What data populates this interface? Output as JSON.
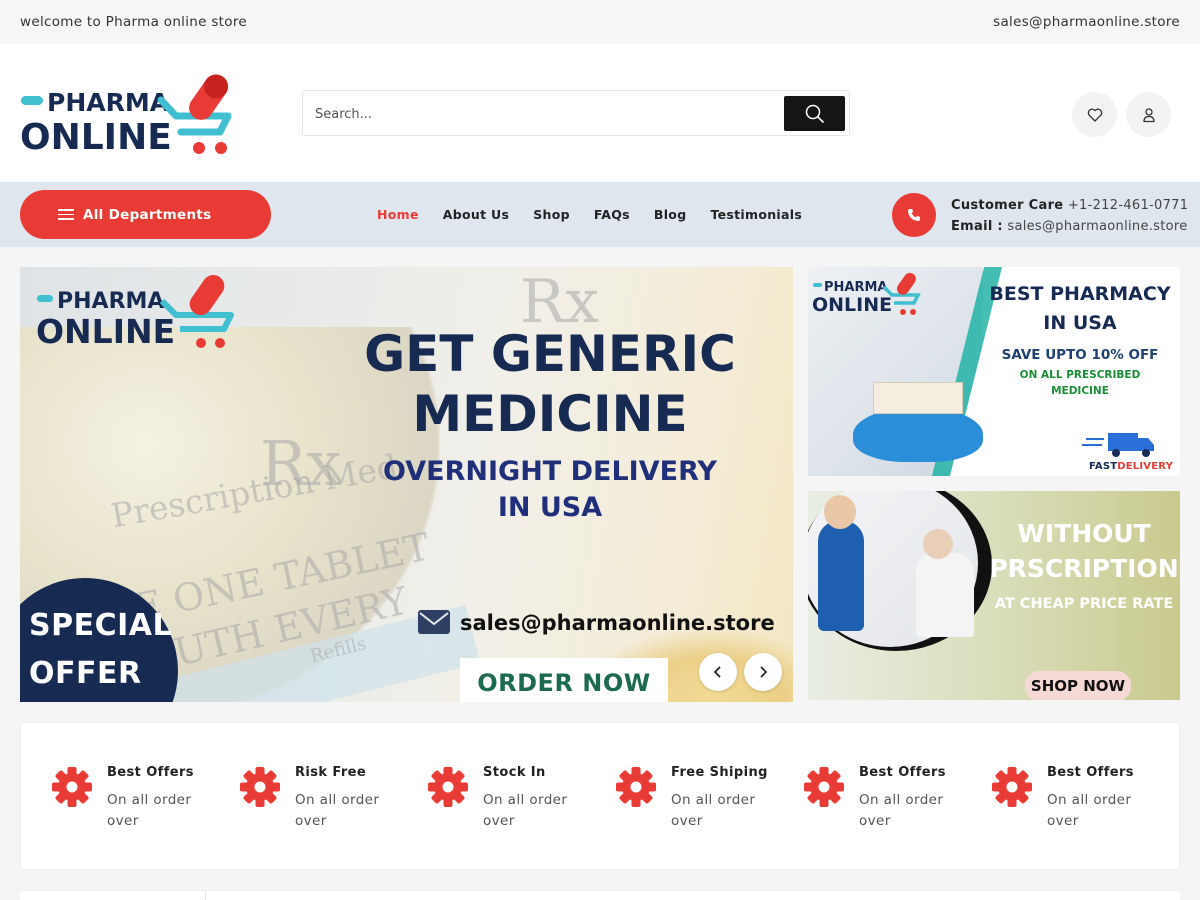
{
  "topbar": {
    "welcome": "welcome to Pharma online store",
    "email": "sales@pharmaonline.store"
  },
  "header": {
    "logo_line1": "PHARMA",
    "logo_line2": "ONLINE",
    "search_placeholder": "Search...",
    "icons": [
      "search-icon",
      "heart-icon",
      "user-icon"
    ]
  },
  "nav": {
    "departments_label": "All Departments",
    "items": [
      {
        "label": "Home",
        "active": true
      },
      {
        "label": "About Us",
        "active": false
      },
      {
        "label": "Shop",
        "active": false
      },
      {
        "label": "FAQs",
        "active": false
      },
      {
        "label": "Blog",
        "active": false
      },
      {
        "label": "Testimonials",
        "active": false
      }
    ],
    "care_label": "Customer Care",
    "care_phone": "+1-212-461-0771",
    "email_label": "Email :",
    "email": "sales@pharmaonline.store"
  },
  "slider": {
    "logo_line1": "PHARMA",
    "logo_line2": "ONLINE",
    "headline1": "GET GENERIC",
    "headline2": "MEDICINE",
    "sub1": "OVERNIGHT DELIVERY",
    "sub2": "IN USA",
    "email": "sales@pharmaonline.store",
    "special1": "SPECIAL",
    "special2": "OFFER",
    "cta": "ORDER NOW",
    "bg_text1": "Rx",
    "bg_text2": "Prescription Med",
    "bg_text3": "E ONE TABLET",
    "bg_text4": "UTH EVERY",
    "bg_text5": "Refills"
  },
  "banner1": {
    "logo_line1": "PHARMA",
    "logo_line2": "ONLINE",
    "title1": "BEST PHARMACY",
    "title2": "IN USA",
    "offer": "SAVE UPTO 10% OFF",
    "note1": "ON ALL PRESCRIBED",
    "note2": "MEDICINE",
    "delivery_fast": "FAST",
    "delivery_word": "DELIVERY"
  },
  "banner2": {
    "title1": "WITHOUT",
    "title2": "PRSCRIPTION",
    "sub": "AT CHEAP PRICE RATE",
    "cta": "SHOP NOW"
  },
  "features": [
    {
      "title": "Best Offers",
      "sub": "On all order over"
    },
    {
      "title": "Risk Free",
      "sub": "On all order over"
    },
    {
      "title": "Stock In",
      "sub": "On all order over"
    },
    {
      "title": "Free Shiping",
      "sub": "On all order over"
    },
    {
      "title": "Best Offers",
      "sub": "On all order over"
    },
    {
      "title": "Best Offers",
      "sub": "On all order over"
    }
  ],
  "colors": {
    "accent": "#e93b36",
    "navy": "#172a52",
    "teal": "#3fbfcf",
    "nav_bg": "#dfe6ee"
  }
}
